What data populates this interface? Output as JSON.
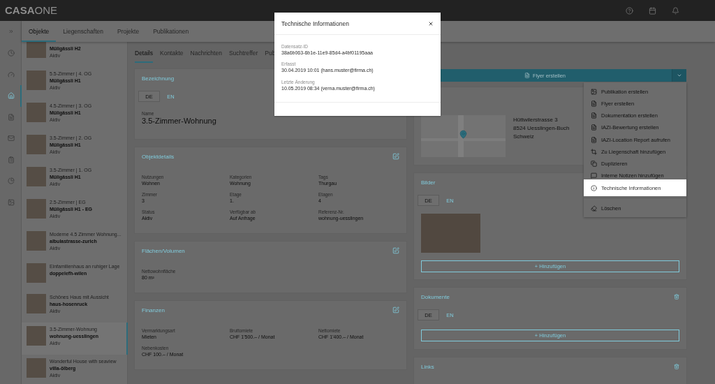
{
  "top_bar": {
    "logo": "**CASA**ONE"
  },
  "rail": {
    "items": [
      {
        "selected": false
      },
      {
        "selected": false
      },
      {
        "selected": true
      },
      {
        "selected": false
      },
      {
        "selected": false
      },
      {
        "selected": false
      },
      {
        "selected": false
      },
      {
        "selected": false
      }
    ]
  },
  "nav_tabs": [
    {
      "label": "Objekte",
      "selected": true
    },
    {
      "label": "Liegenschaften",
      "selected": false
    },
    {
      "label": "Projekte",
      "selected": false
    },
    {
      "label": "Publikationen",
      "selected": false
    }
  ],
  "object_list": [
    {
      "name": "Müligässli H2",
      "status": "Aktiv",
      "selected": false
    },
    {
      "title": "5.5-Zimmer | 4. OG",
      "name": "Müligässli H1",
      "status": "Aktiv",
      "selected": false
    },
    {
      "title": "4.5-Zimmer | 3. OG",
      "name": "Müligässli H1",
      "status": "Aktiv",
      "selected": false
    },
    {
      "title": "3.5-Zimmer | 2. OG",
      "name": "Müligässli H1",
      "status": "Aktiv",
      "selected": false
    },
    {
      "title": "3.5-Zimmer | 1. OG",
      "name": "Müligässli H1",
      "status": "Aktiv",
      "selected": false
    },
    {
      "title": "2.5-Zimmer | EG",
      "name": "Müligässli H1 - EG",
      "status": "Aktiv",
      "selected": false
    },
    {
      "title": "Moderne 4.5 Zimmer Wohnung...",
      "name": "albulastrasse-zurich",
      "status": "Aktiv",
      "selected": false
    },
    {
      "title": "Einfamilienhaus an ruhiger Lage",
      "name": "doppelefh-wilen",
      "selected": false
    },
    {
      "title": "Schönes Haus mit Aussicht",
      "name": "haus-hosenruck",
      "status": "Aktiv",
      "selected": false
    },
    {
      "title": "3.5-Zimmer-Wohnung",
      "name": "wohnung-uesslingen",
      "status": "Aktiv",
      "selected": true
    },
    {
      "title": "Wonderful House with seaview",
      "name": "villa-ölberg",
      "status": "Aktiv",
      "selected": false
    }
  ],
  "detail_tabs": [
    {
      "label": "Details",
      "selected": true
    },
    {
      "label": "Kontakte",
      "selected": false
    },
    {
      "label": "Nachrichten",
      "selected": false
    },
    {
      "label": "Suchtreffer",
      "selected": false
    },
    {
      "label": "Pub",
      "selected": false
    }
  ],
  "left_cards": [
    {
      "kind": "name",
      "title": "Bezeichnung",
      "lang_tabs": [
        {
          "label": "DE",
          "selected": true
        },
        {
          "label": "EN",
          "selected": false
        }
      ],
      "fields": [
        {
          "label": "Name",
          "value": "3.5-Zimmer-Wohnung"
        }
      ]
    },
    {
      "kind": "grid",
      "title": "Objektdetails",
      "editable": true,
      "fields": [
        {
          "label": "Nutzungen",
          "value": "Wohnen"
        },
        {
          "label": "Kategorien",
          "value": "Wohnung"
        },
        {
          "label": "Tags",
          "value": "Thurgau"
        },
        {
          "label": "Zimmer",
          "value": "3"
        },
        {
          "label": "Etage",
          "value": "1."
        },
        {
          "label": "Etagen",
          "value": "4"
        },
        {
          "label": "Status",
          "value": "Aktiv"
        },
        {
          "label": "Verfügbar ab",
          "value": "Auf Anfrage"
        },
        {
          "label": "Referenz-Nr.",
          "value": "wohnung-uesslingen"
        }
      ]
    },
    {
      "kind": "grid",
      "title": "Flächen/Volumen",
      "editable": true,
      "fields": [
        {
          "label": "Nettowohnfläche",
          "value": "80 m²"
        }
      ]
    },
    {
      "kind": "grid",
      "title": "Finanzen",
      "editable": true,
      "fields": [
        {
          "label": "Vermarktungsart",
          "value": "Mieten"
        },
        {
          "label": "Bruttomiete",
          "value": "CHF 1'500.– / Monat"
        },
        {
          "label": "Nettomiete",
          "value": "CHF 1'400.– / Monat"
        },
        {
          "label": "Nebenkosten",
          "value": "CHF 100.– / Monat"
        }
      ]
    }
  ],
  "actions": {
    "primary": "Flyer erstellen",
    "expanded": true,
    "menu_groups": [
      {
        "items": [
          {
            "label": "Publikation erstellen",
            "highlighted": false
          },
          {
            "label": "Flyer erstellen",
            "highlighted": false
          },
          {
            "label": "Dokumentation erstellen",
            "highlighted": false
          },
          {
            "label": "IAZI-Bewertung erstellen",
            "highlighted": false
          },
          {
            "label": "IAZI-Location Report aufrufen",
            "highlighted": false
          },
          {
            "label": "Zu Liegenschaft hinzufügen",
            "highlighted": false
          },
          {
            "label": "Duplizieren",
            "highlighted": false
          },
          {
            "label": "Interne Notizen hinzufügen",
            "highlighted": false
          },
          {
            "label": "Technische Informationen",
            "highlighted": true
          }
        ]
      },
      {
        "items": [
          {
            "label": "Löschen",
            "highlighted": false
          }
        ]
      }
    ]
  },
  "right_cards": [
    {
      "kind": "location",
      "address_lines": [
        "Hüttwilerstrasse 3",
        "8524 Uesslingen-Buch",
        "Schweiz"
      ]
    },
    {
      "kind": "gallery",
      "title": "Bilder",
      "lang_tabs": [
        {
          "label": "DE",
          "selected": true
        },
        {
          "label": "EN",
          "selected": false
        }
      ],
      "add_label": "+ Hinzufügen"
    },
    {
      "kind": "list",
      "title": "Dokumente",
      "removable": true,
      "lang_tabs": [
        {
          "label": "DE",
          "selected": true
        },
        {
          "label": "EN",
          "selected": false
        }
      ],
      "add_label": "+ Hinzufügen"
    },
    {
      "kind": "list",
      "title": "Links",
      "removable": true
    }
  ],
  "dialog": {
    "title": "Technische Informationen",
    "fields": [
      {
        "label": "Datensatz-ID",
        "value": "38a6b063-6b1e-11e9-85d4-a4bf01195aaa"
      },
      {
        "label": "Erfasst",
        "value": "30.04.2019 10:01 (hans.muster@firma.ch)"
      },
      {
        "label": "Letzte Änderung",
        "value": "10.05.2019 08:34 (verna.muster@firma.ch)"
      }
    ]
  }
}
